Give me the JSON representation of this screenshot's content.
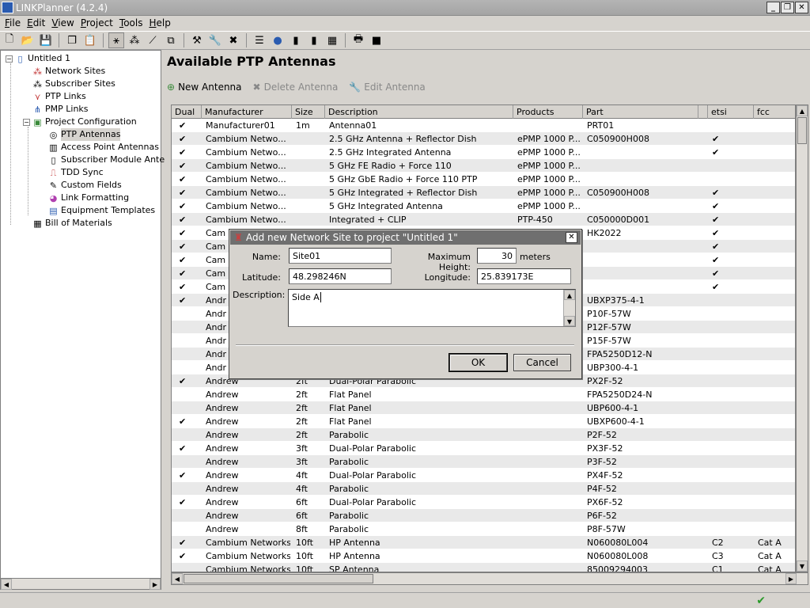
{
  "window": {
    "title": "LINKPlanner (4.2.4)"
  },
  "menu": [
    {
      "label": "File",
      "mn": "F",
      "rest": "ile"
    },
    {
      "label": "Edit",
      "mn": "E",
      "rest": "dit"
    },
    {
      "label": "View",
      "mn": "V",
      "rest": "iew"
    },
    {
      "label": "Project",
      "mn": "P",
      "rest": "roject"
    },
    {
      "label": "Tools",
      "mn": "T",
      "rest": "ools"
    },
    {
      "label": "Help",
      "mn": "H",
      "rest": "elp"
    }
  ],
  "tree": {
    "root": "Untitled 1",
    "network_sites": "Network Sites",
    "subscriber_sites": "Subscriber Sites",
    "ptp_links": "PTP Links",
    "pmp_links": "PMP Links",
    "project_configuration": "Project Configuration",
    "ptp_antennas": "PTP Antennas",
    "access_point_antennas": "Access Point Antennas",
    "subscriber_module_antennas": "Subscriber Module Ante",
    "tdd_sync": "TDD Sync",
    "custom_fields": "Custom Fields",
    "link_formatting": "Link Formatting",
    "equipment_templates": "Equipment Templates",
    "bill_of_materials": "Bill of Materials"
  },
  "panel": {
    "title": "Available PTP Antennas",
    "new_antenna": "New Antenna",
    "delete_antenna": "Delete Antenna",
    "edit_antenna": "Edit Antenna"
  },
  "table": {
    "headers": [
      "Dual",
      "Manufacturer",
      "Size",
      "Description",
      "Products",
      "Part",
      "",
      "etsi",
      "fcc"
    ],
    "rows": [
      {
        "dual": "✔",
        "mfr": "Manufacturer01",
        "size": "1m",
        "desc": "Antenna01",
        "prod": "",
        "part": "PRT01",
        "etsi": "",
        "fcc": ""
      },
      {
        "dual": "✔",
        "mfr": "Cambium Netwo...",
        "size": "",
        "desc": "2.5 GHz Antenna + Reflector Dish",
        "prod": "ePMP 1000 P...",
        "part": "C050900H008",
        "etsi": "✔",
        "fcc": ""
      },
      {
        "dual": "✔",
        "mfr": "Cambium Netwo...",
        "size": "",
        "desc": "2.5 GHz Integrated Antenna",
        "prod": "ePMP 1000 P...",
        "part": "",
        "etsi": "✔",
        "fcc": ""
      },
      {
        "dual": "✔",
        "mfr": "Cambium Netwo...",
        "size": "",
        "desc": "5 GHz FE Radio + Force 110",
        "prod": "ePMP 1000 P...",
        "part": "",
        "etsi": "",
        "fcc": ""
      },
      {
        "dual": "✔",
        "mfr": "Cambium Netwo...",
        "size": "",
        "desc": "5 GHz GbE Radio + Force 110 PTP",
        "prod": "ePMP 1000 P...",
        "part": "",
        "etsi": "",
        "fcc": ""
      },
      {
        "dual": "✔",
        "mfr": "Cambium Netwo...",
        "size": "",
        "desc": "5 GHz Integrated + Reflector Dish",
        "prod": "ePMP 1000 P...",
        "part": "C050900H008",
        "etsi": "✔",
        "fcc": ""
      },
      {
        "dual": "✔",
        "mfr": "Cambium Netwo...",
        "size": "",
        "desc": "5 GHz Integrated Antenna",
        "prod": "ePMP 1000 P...",
        "part": "",
        "etsi": "✔",
        "fcc": ""
      },
      {
        "dual": "✔",
        "mfr": "Cambium Netwo...",
        "size": "",
        "desc": "Integrated + CLIP",
        "prod": "PTP-450",
        "part": "C050000D001",
        "etsi": "✔",
        "fcc": ""
      },
      {
        "dual": "✔",
        "mfr": "Cam",
        "size": "",
        "desc": "",
        "prod": "",
        "part": "HK2022",
        "etsi": "✔",
        "fcc": ""
      },
      {
        "dual": "✔",
        "mfr": "Cam",
        "size": "",
        "desc": "",
        "prod": "",
        "part": "",
        "etsi": "✔",
        "fcc": ""
      },
      {
        "dual": "✔",
        "mfr": "Cam",
        "size": "",
        "desc": "",
        "prod": "",
        "part": "",
        "etsi": "✔",
        "fcc": ""
      },
      {
        "dual": "✔",
        "mfr": "Cam",
        "size": "",
        "desc": "",
        "prod": "",
        "part": "",
        "etsi": "✔",
        "fcc": ""
      },
      {
        "dual": "✔",
        "mfr": "Cam",
        "size": "",
        "desc": "",
        "prod": "",
        "part": "",
        "etsi": "✔",
        "fcc": ""
      },
      {
        "dual": "✔",
        "mfr": "Andr",
        "size": "",
        "desc": "",
        "prod": "",
        "part": "UBXP375-4-1",
        "etsi": "",
        "fcc": ""
      },
      {
        "dual": "",
        "mfr": "Andr",
        "size": "",
        "desc": "",
        "prod": "",
        "part": "P10F-57W",
        "etsi": "",
        "fcc": ""
      },
      {
        "dual": "",
        "mfr": "Andr",
        "size": "",
        "desc": "",
        "prod": "",
        "part": "P12F-57W",
        "etsi": "",
        "fcc": ""
      },
      {
        "dual": "",
        "mfr": "Andr",
        "size": "",
        "desc": "",
        "prod": "",
        "part": "P15F-57W",
        "etsi": "",
        "fcc": ""
      },
      {
        "dual": "",
        "mfr": "Andr",
        "size": "",
        "desc": "",
        "prod": "",
        "part": "FPA5250D12-N",
        "etsi": "",
        "fcc": ""
      },
      {
        "dual": "",
        "mfr": "Andr",
        "size": "",
        "desc": "",
        "prod": "",
        "part": "UBP300-4-1",
        "etsi": "",
        "fcc": ""
      },
      {
        "dual": "✔",
        "mfr": "Andrew",
        "size": "2ft",
        "desc": "Dual-Polar Parabolic",
        "prod": "",
        "part": "PX2F-52",
        "etsi": "",
        "fcc": ""
      },
      {
        "dual": "",
        "mfr": "Andrew",
        "size": "2ft",
        "desc": "Flat Panel",
        "prod": "",
        "part": "FPA5250D24-N",
        "etsi": "",
        "fcc": ""
      },
      {
        "dual": "",
        "mfr": "Andrew",
        "size": "2ft",
        "desc": "Flat Panel",
        "prod": "",
        "part": "UBP600-4-1",
        "etsi": "",
        "fcc": ""
      },
      {
        "dual": "✔",
        "mfr": "Andrew",
        "size": "2ft",
        "desc": "Flat Panel",
        "prod": "",
        "part": "UBXP600-4-1",
        "etsi": "",
        "fcc": ""
      },
      {
        "dual": "",
        "mfr": "Andrew",
        "size": "2ft",
        "desc": "Parabolic",
        "prod": "",
        "part": "P2F-52",
        "etsi": "",
        "fcc": ""
      },
      {
        "dual": "✔",
        "mfr": "Andrew",
        "size": "3ft",
        "desc": "Dual-Polar Parabolic",
        "prod": "",
        "part": "PX3F-52",
        "etsi": "",
        "fcc": ""
      },
      {
        "dual": "",
        "mfr": "Andrew",
        "size": "3ft",
        "desc": "Parabolic",
        "prod": "",
        "part": "P3F-52",
        "etsi": "",
        "fcc": ""
      },
      {
        "dual": "✔",
        "mfr": "Andrew",
        "size": "4ft",
        "desc": "Dual-Polar Parabolic",
        "prod": "",
        "part": "PX4F-52",
        "etsi": "",
        "fcc": ""
      },
      {
        "dual": "",
        "mfr": "Andrew",
        "size": "4ft",
        "desc": "Parabolic",
        "prod": "",
        "part": "P4F-52",
        "etsi": "",
        "fcc": ""
      },
      {
        "dual": "✔",
        "mfr": "Andrew",
        "size": "6ft",
        "desc": "Dual-Polar Parabolic",
        "prod": "",
        "part": "PX6F-52",
        "etsi": "",
        "fcc": ""
      },
      {
        "dual": "",
        "mfr": "Andrew",
        "size": "6ft",
        "desc": "Parabolic",
        "prod": "",
        "part": "P6F-52",
        "etsi": "",
        "fcc": ""
      },
      {
        "dual": "",
        "mfr": "Andrew",
        "size": "8ft",
        "desc": "Parabolic",
        "prod": "",
        "part": "P8F-57W",
        "etsi": "",
        "fcc": ""
      },
      {
        "dual": "✔",
        "mfr": "Cambium Networks",
        "size": "10ft",
        "desc": "HP Antenna",
        "prod": "",
        "part": "N060080L004",
        "etsi": "C2",
        "fcc": "Cat A"
      },
      {
        "dual": "✔",
        "mfr": "Cambium Networks",
        "size": "10ft",
        "desc": "HP Antenna",
        "prod": "",
        "part": "N060080L008",
        "etsi": "C3",
        "fcc": "Cat A"
      },
      {
        "dual": "",
        "mfr": "Cambium Networks",
        "size": "10ft",
        "desc": "SP Antenna",
        "prod": "",
        "part": "85009294003",
        "etsi": "C1",
        "fcc": "Cat A"
      }
    ]
  },
  "dialog": {
    "title": "Add new Network Site to project \"Untitled 1\"",
    "name_label": "Name:",
    "name_value": "Site01",
    "max_height_label": "Maximum Height:",
    "max_height_value": "30",
    "max_height_unit": "meters",
    "latitude_label": "Latitude:",
    "latitude_value": "48.298246N",
    "longitude_label": "Longitude:",
    "longitude_value": "25.839173E",
    "description_label": "Description:",
    "description_value": "Side A",
    "ok": "OK",
    "cancel": "Cancel"
  },
  "toolbar_icons": [
    "new-project-icon",
    "open-project-icon",
    "save-icon",
    "copy-icon",
    "paste-icon",
    "select-tool-icon",
    "add-site-icon",
    "add-link-icon",
    "add-equipment-icon",
    "hammer-icon",
    "wrench-icon",
    "delete-icon",
    "chart-icon",
    "globe-icon",
    "report-icon",
    "report2-icon",
    "table-icon",
    "print-icon",
    "export-icon"
  ]
}
